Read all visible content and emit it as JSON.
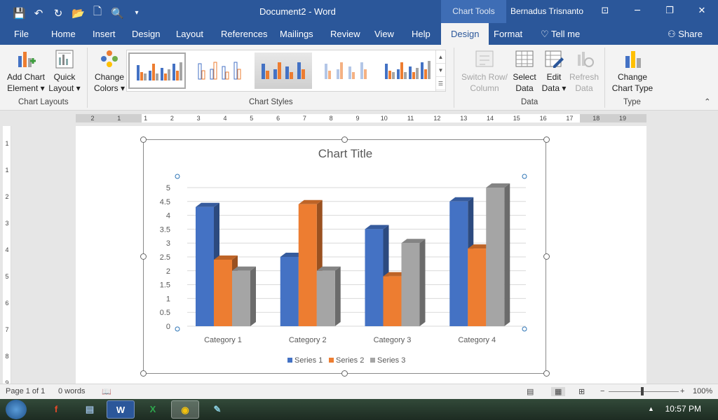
{
  "titlebar": {
    "doc_title": "Document2  -  Word",
    "context_tools": "Chart Tools",
    "user": "Bernadus Trisnanto",
    "qat": [
      "save-icon",
      "undo-icon",
      "redo-icon",
      "open-icon",
      "new-icon",
      "print-preview-icon",
      "customize-icon"
    ],
    "qat_glyphs": [
      "💾",
      "↶",
      "↻",
      "📂",
      "🗋",
      "🔍",
      "▾"
    ],
    "win_glyphs": [
      "⊡",
      "─",
      "❐",
      "✕"
    ]
  },
  "tabs": {
    "items": [
      "File",
      "Home",
      "Insert",
      "Design",
      "Layout",
      "References",
      "Mailings",
      "Review",
      "View",
      "Help"
    ],
    "ctx_design": "Design",
    "ctx_format": "Format",
    "tellme": "♡  Tell me",
    "share": "⚇ Share"
  },
  "ribbon": {
    "add_chart_element": "Add Chart Element ▾",
    "quick_layout": "Quick Layout ▾",
    "change_colors": "Change Colors ▾",
    "switch_row_column": "Switch Row/ Column",
    "select_data": "Select Data",
    "edit_data": "Edit Data ▾",
    "refresh_data": "Refresh Data",
    "change_chart_type": "Change Chart Type",
    "groups": {
      "chart_layouts": "Chart Layouts",
      "chart_styles": "Chart Styles",
      "data": "Data",
      "type": "Type"
    }
  },
  "ruler": {
    "top_numbers": [
      "2",
      "1",
      "1",
      "2",
      "3",
      "4",
      "5",
      "6",
      "7",
      "8",
      "9",
      "10",
      "11",
      "12",
      "13",
      "14",
      "15",
      "16",
      "17",
      "18",
      "19"
    ],
    "side_numbers": [
      "1",
      "1",
      "2",
      "3",
      "4",
      "5",
      "6",
      "7",
      "8",
      "9"
    ]
  },
  "chart_data": {
    "type": "bar",
    "title": "Chart Title",
    "categories": [
      "Category 1",
      "Category 2",
      "Category 3",
      "Category 4"
    ],
    "series": [
      {
        "name": "Series 1",
        "values": [
          4.3,
          2.5,
          3.5,
          4.5
        ],
        "color": "#4472c4"
      },
      {
        "name": "Series 2",
        "values": [
          2.4,
          4.4,
          1.8,
          2.8
        ],
        "color": "#ed7d31"
      },
      {
        "name": "Series 3",
        "values": [
          2.0,
          2.0,
          3.0,
          5.0
        ],
        "color": "#a5a5a5"
      }
    ],
    "ylim": [
      0,
      5
    ],
    "yticks": [
      "0",
      "0.5",
      "1",
      "1.5",
      "2",
      "2.5",
      "3",
      "3.5",
      "4",
      "4.5",
      "5"
    ],
    "grid": true,
    "legend": "bottom",
    "style": "3d-clustered-column"
  },
  "statusbar": {
    "page": "Page 1 of 1",
    "words": "0 words",
    "zoom": "100%",
    "zoom_minus": "−",
    "zoom_plus": "+"
  },
  "taskbar": {
    "apps": [
      "flash-app",
      "notepad-app",
      "word-app",
      "excel-app",
      "chrome-app",
      "paint-app"
    ],
    "clock": "10:57 PM",
    "tray_arrow": "▲"
  }
}
